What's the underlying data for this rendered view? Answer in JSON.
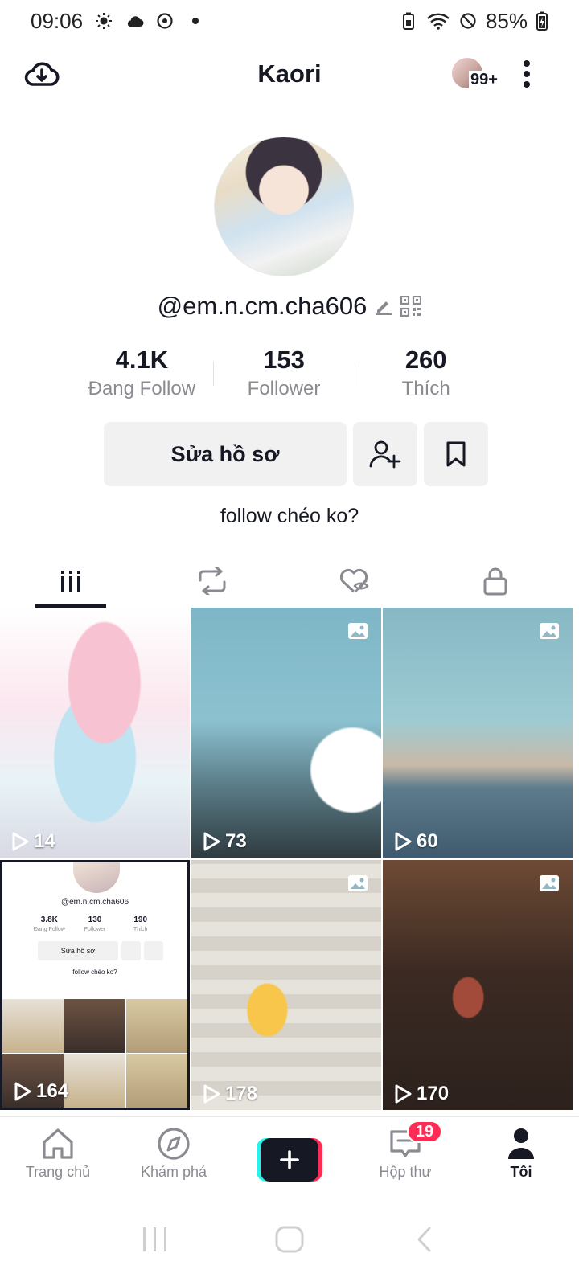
{
  "status_bar": {
    "time": "09:06",
    "battery": "85%"
  },
  "header": {
    "title": "Kaori",
    "notification_count": "99+"
  },
  "profile": {
    "username": "@em.n.cm.cha606",
    "stats": [
      {
        "value": "4.1K",
        "label": "Đang Follow"
      },
      {
        "value": "153",
        "label": "Follower"
      },
      {
        "value": "260",
        "label": "Thích"
      }
    ],
    "edit_button": "Sửa hồ sơ",
    "bio": "follow chéo ko?"
  },
  "tabs": [
    {
      "icon": "grid-videos-icon",
      "active": true
    },
    {
      "icon": "repost-icon",
      "active": false
    },
    {
      "icon": "liked-hidden-icon",
      "active": false
    },
    {
      "icon": "lock-icon",
      "active": false
    }
  ],
  "videos": [
    {
      "views": "14",
      "is_photo": false
    },
    {
      "views": "73",
      "is_photo": true
    },
    {
      "views": "60",
      "is_photo": true
    },
    {
      "views": "164",
      "is_photo": false
    },
    {
      "views": "178",
      "is_photo": true
    },
    {
      "views": "170",
      "is_photo": true
    }
  ],
  "mini_profile": {
    "username": "@em.n.cm.cha606",
    "stats": [
      {
        "value": "3.8K",
        "label": "Đang Follow"
      },
      {
        "value": "130",
        "label": "Follower"
      },
      {
        "value": "190",
        "label": "Thích"
      }
    ],
    "edit_button": "Sửa hồ sơ",
    "bio": "follow chéo ko?"
  },
  "bottom_nav": {
    "home": "Trang chủ",
    "discover": "Khám phá",
    "inbox": "Hộp thư",
    "inbox_badge": "19",
    "me": "Tôi"
  },
  "colors": {
    "text_primary": "#161823",
    "text_secondary": "#8a8b91",
    "button_bg": "#f1f1f2",
    "accent_red": "#fe2c55",
    "accent_cyan": "#25f4ee"
  }
}
